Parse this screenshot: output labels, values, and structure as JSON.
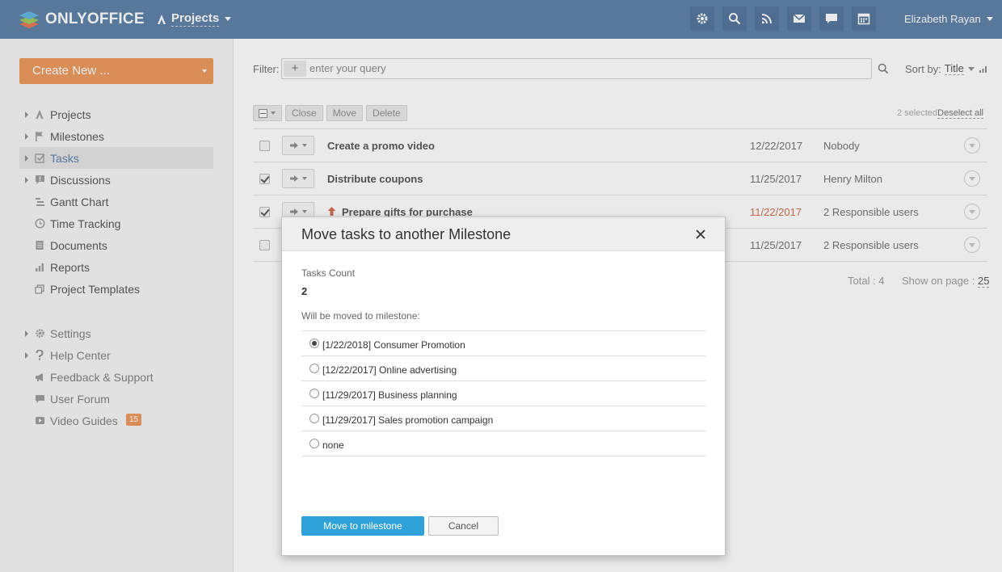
{
  "header": {
    "logo_text": "ONLYOFFICE",
    "module_label": "Projects",
    "icons": [
      "gear-icon",
      "search-icon",
      "feed-icon",
      "mail-icon",
      "chat-icon",
      "calendar-icon"
    ],
    "user_name": "Elizabeth Rayan",
    "bg_color": "#3b6796"
  },
  "sidebar": {
    "create_label": "Create New ...",
    "items": [
      {
        "label": "Projects",
        "icon": "projects-icon"
      },
      {
        "label": "Milestones",
        "icon": "flag-icon"
      },
      {
        "label": "Tasks",
        "icon": "task-check-icon"
      },
      {
        "label": "Discussions",
        "icon": "discussions-icon"
      },
      {
        "label": "Gantt Chart",
        "icon": "gantt-icon"
      },
      {
        "label": "Time Tracking",
        "icon": "clock-icon"
      },
      {
        "label": "Documents",
        "icon": "document-icon"
      },
      {
        "label": "Reports",
        "icon": "reports-icon"
      },
      {
        "label": "Project Templates",
        "icon": "templates-icon"
      }
    ],
    "support_items": [
      {
        "label": "Settings",
        "icon": "gear-icon"
      },
      {
        "label": "Help Center",
        "icon": "help-icon"
      },
      {
        "label": "Feedback & Support",
        "icon": "megaphone-icon"
      },
      {
        "label": "User Forum",
        "icon": "forum-icon"
      },
      {
        "label": "Video Guides",
        "icon": "video-icon",
        "badge": "15"
      }
    ]
  },
  "filter": {
    "label": "Filter:",
    "plus": "+",
    "placeholder": "enter your query",
    "sort_label": "Sort by:",
    "sort_value": "Title"
  },
  "toolbar": {
    "close": "Close",
    "move": "Move",
    "delete": "Delete",
    "selected": "2 selected",
    "deselect": "Deselect all"
  },
  "tasks": [
    {
      "name": "Create a promo video",
      "date": "12/22/2017",
      "responsible": "Nobody",
      "checked": false,
      "overdue": false,
      "high_priority": false
    },
    {
      "name": "Distribute coupons",
      "date": "11/25/2017",
      "responsible": "Henry Milton",
      "checked": true,
      "overdue": false,
      "high_priority": false
    },
    {
      "name": "Prepare gifts for purchase",
      "date": "11/22/2017",
      "responsible": "2 Responsible users",
      "checked": true,
      "overdue": true,
      "high_priority": true
    },
    {
      "name": "",
      "date": "11/25/2017",
      "responsible": "2 Responsible users",
      "checked": false,
      "overdue": false,
      "high_priority": false
    }
  ],
  "footer": {
    "total": "Total : 4",
    "show_on_page_label": "Show on page :",
    "show_on_page_value": "25"
  },
  "dialog": {
    "title": "Move tasks to another Milestone",
    "tasks_count_label": "Tasks Count",
    "tasks_count": "2",
    "moved_label": "Will be moved to milestone:",
    "options": [
      {
        "label": "[1/22/2018] Consumer Promotion",
        "selected": true
      },
      {
        "label": "[12/22/2017] Online advertising",
        "selected": false
      },
      {
        "label": "[11/29/2017] Business planning",
        "selected": false
      },
      {
        "label": "[11/29/2017] Sales promotion campaign",
        "selected": false
      },
      {
        "label": "none",
        "selected": false
      }
    ],
    "move_button": "Move to milestone",
    "cancel_button": "Cancel"
  }
}
